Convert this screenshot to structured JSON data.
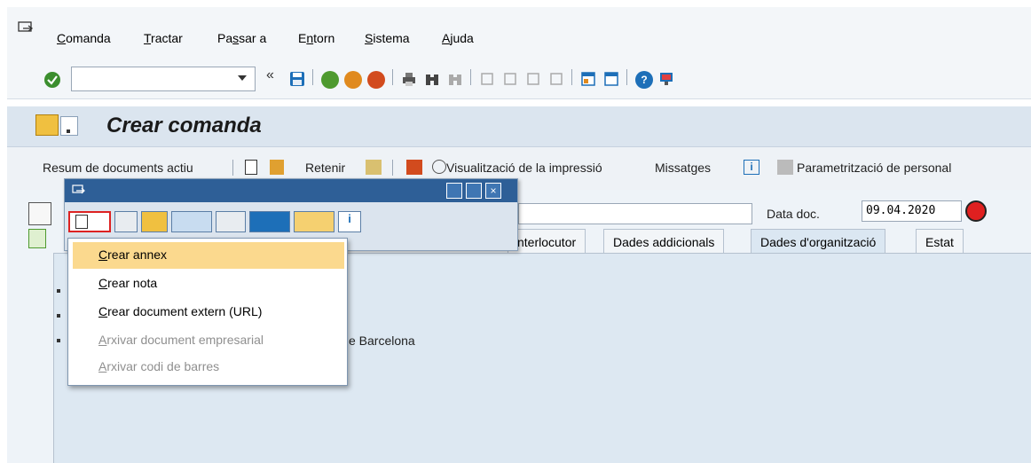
{
  "menubar": {
    "items": [
      {
        "label": "Comanda",
        "underline": "C",
        "rest": "omanda"
      },
      {
        "label": "Tractar",
        "underline": "T",
        "rest": "ractar"
      },
      {
        "label": "Passar a",
        "pre": "Pa",
        "underline": "s",
        "rest": "sar a"
      },
      {
        "label": "Entorn",
        "pre": "E",
        "underline": "n",
        "rest": "torn"
      },
      {
        "label": "Sistema",
        "underline": "S",
        "rest": "istema"
      },
      {
        "label": "Ajuda",
        "underline": "A",
        "rest": "juda"
      }
    ]
  },
  "toolbar": {
    "command_value": ""
  },
  "title": {
    "text": "Crear comanda"
  },
  "app_toolbar": {
    "summary": "Resum de documents actiu",
    "hold": "Retenir",
    "print_preview": "Visualització de la impressió",
    "messages": "Missatges",
    "personal_settings": "Parametrització de personal"
  },
  "header": {
    "doc_date_label": "Data doc.",
    "doc_date_value": "09.04.2020"
  },
  "tabs": [
    "nterlocutor",
    "Dades addicionals",
    "Dades d'organització",
    "Estat"
  ],
  "tab_content": {
    "text": "e Barcelona"
  },
  "dropdown": {
    "items": [
      {
        "u": "C",
        "rest": "rear annex",
        "state": "highlighted"
      },
      {
        "u": "C",
        "rest": "rear nota",
        "state": "normal"
      },
      {
        "u": "C",
        "rest": "rear document extern (URL)",
        "state": "normal"
      },
      {
        "u": "A",
        "rest": "rxivar document empresarial",
        "state": "disabled"
      },
      {
        "u": "A",
        "rest": "rxivar codi de barres",
        "state": "disabled"
      }
    ]
  },
  "colors": {
    "accent": "#2e5f97",
    "highlight": "#fbd98e",
    "title_bg": "#dbe5ef",
    "content_bg": "#eef3f8"
  }
}
